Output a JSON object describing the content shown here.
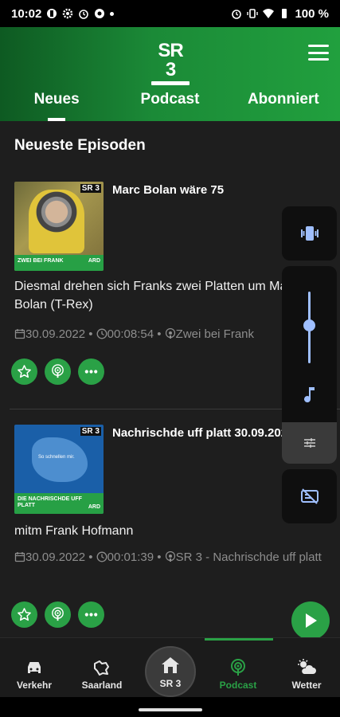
{
  "status_bar": {
    "time": "10:02",
    "battery": "100 %"
  },
  "header": {
    "logo_text": "SR 3",
    "tabs": [
      {
        "label": "Neues",
        "active": true
      },
      {
        "label": "Podcast",
        "active": false
      },
      {
        "label": "Abonniert",
        "active": false
      }
    ]
  },
  "main": {
    "section_title": "Neueste Episoden",
    "episodes": [
      {
        "title": "Marc Bolan wäre 75",
        "thumb_badge": "SR 3",
        "thumb_label": "ZWEI BEI FRANK",
        "thumb_brand": "ARD",
        "description": "Diesmal drehen sich Franks zwei Platten um Marc Bolan (T-Rex)",
        "date": "30.09.2022",
        "duration": "00:08:54",
        "podcast": "Zwei bei Frank"
      },
      {
        "title": "Nachrischde uff platt 30.09.2022",
        "thumb_badge": "SR 3",
        "thumb_label": "DIE NACHRISCHDE UFF PLATT",
        "thumb_brand": "ARD",
        "thumb_map_text": "So schnellen mir.",
        "description": "mitm Frank Hofmann",
        "date": "30.09.2022",
        "duration": "00:01:39",
        "podcast": "SR 3 - Nachrischde uff platt"
      }
    ]
  },
  "bottom_nav": {
    "items": [
      {
        "label": "Verkehr",
        "icon": "car-icon"
      },
      {
        "label": "Saarland",
        "icon": "saarland-map-icon"
      },
      {
        "label": "SR 3",
        "icon": "home-icon"
      },
      {
        "label": "Podcast",
        "icon": "podcast-icon",
        "active": true
      },
      {
        "label": "Wetter",
        "icon": "weather-icon"
      }
    ]
  },
  "colors": {
    "accent": "#2aa146",
    "header_dark": "#0e5a22",
    "background": "#1e1e1e"
  }
}
